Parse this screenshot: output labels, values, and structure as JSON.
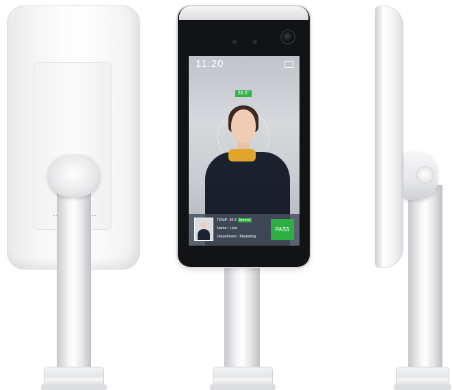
{
  "screen": {
    "clock": "11:20",
    "temp_badge": "36.5°",
    "info": {
      "temp_label": "TEMP:",
      "temp_value": "36.5",
      "temp_status": "Normal",
      "name_line": "Name : Lina",
      "department_line": "Department : Marketing"
    },
    "pass_label": "PASS"
  },
  "colors": {
    "status_green": "#36b24a",
    "bezel": "#121315",
    "body_white": "#f4f5f6"
  }
}
